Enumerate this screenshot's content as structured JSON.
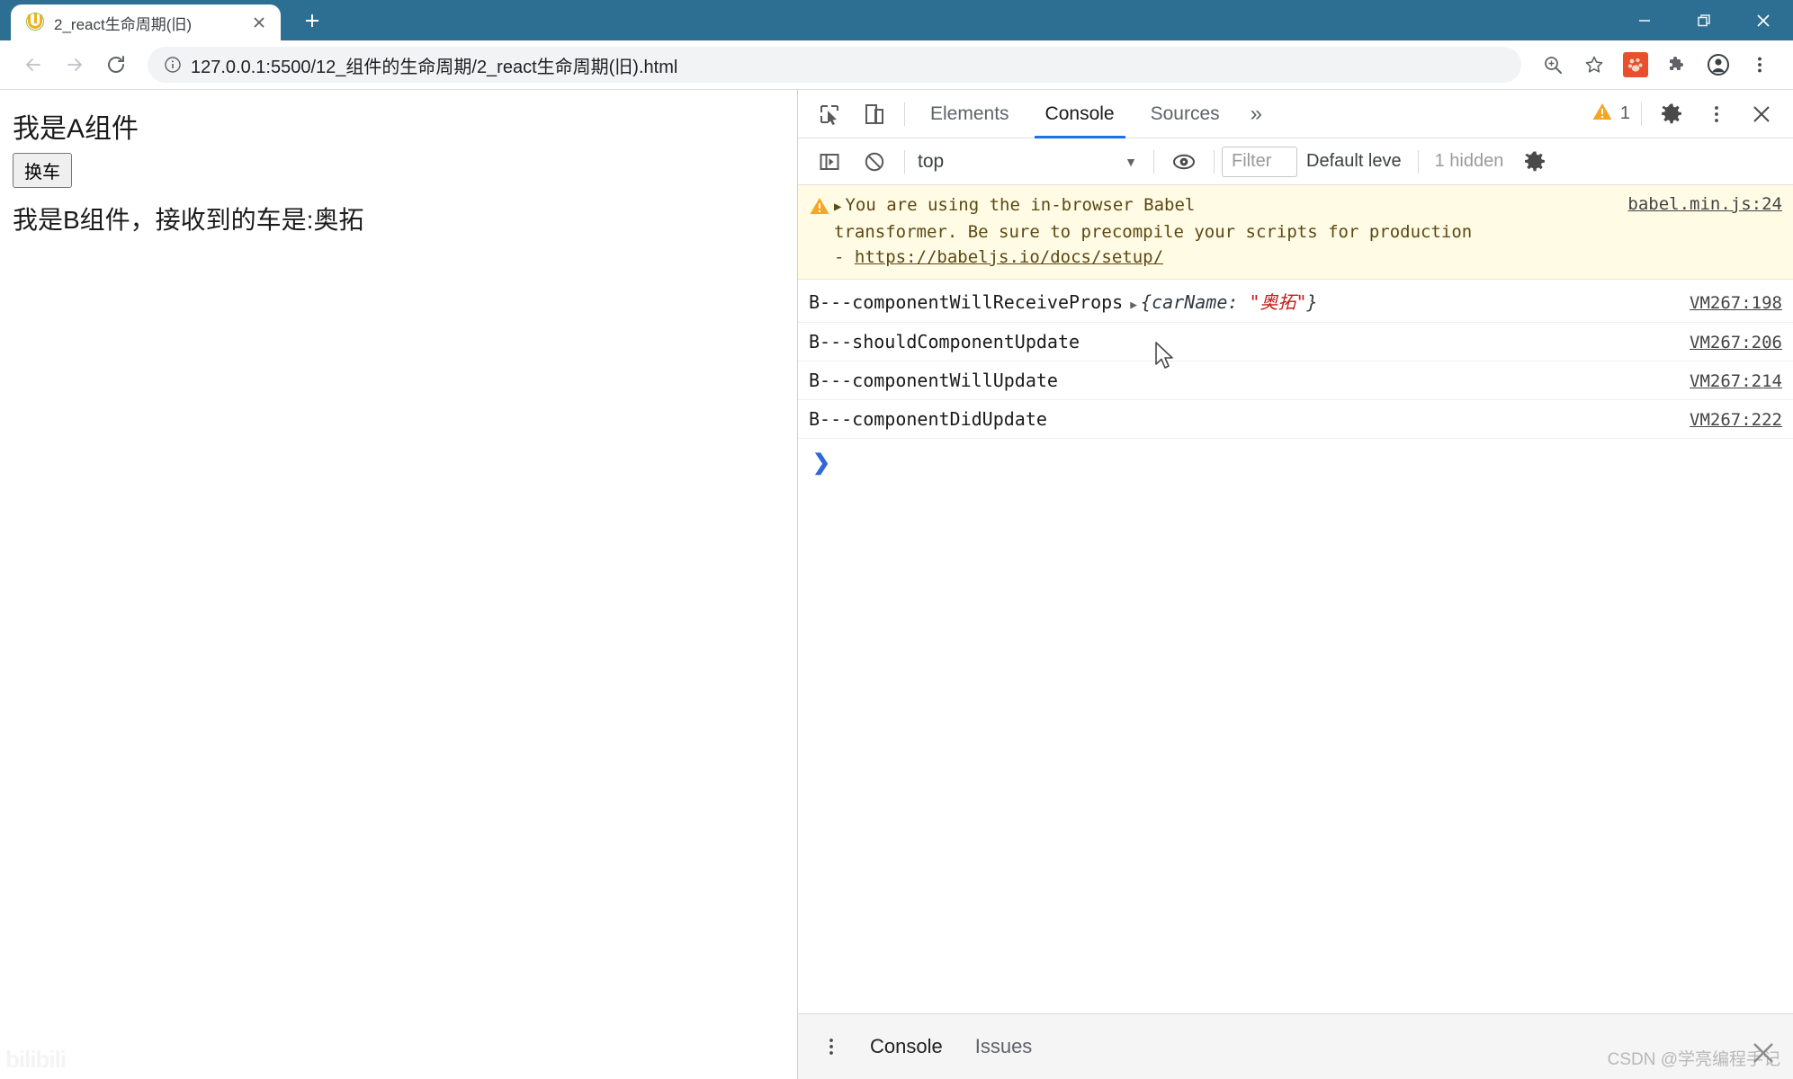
{
  "browser": {
    "tab": {
      "title": "2_react生命周期(旧)",
      "favicon": "live-server-icon",
      "close_label": "✕"
    },
    "new_tab_label": "+",
    "window_controls": {
      "minimize": "—",
      "maximize": "❐",
      "close": "✕"
    },
    "nav": {
      "back": "←",
      "forward": "→",
      "reload": "⟳"
    },
    "omnibox": {
      "info_icon": "info-circle-icon",
      "url": "127.0.0.1:5500/12_组件的生命周期/2_react生命周期(旧).html"
    },
    "toolbar_icons": [
      "zoom-icon",
      "bookmark-star-icon",
      "extension-red-icon",
      "puzzle-extensions-icon",
      "profile-avatar-icon",
      "browser-menu-icon"
    ]
  },
  "page": {
    "heading_a": "我是A组件",
    "button_label": "换车",
    "text_b": "我是B组件，接收到的车是:奥拓",
    "watermark": "bilibili"
  },
  "devtools": {
    "topbar": {
      "inspect_icon": "inspect-element-icon",
      "device_icon": "device-toolbar-icon",
      "tabs": [
        {
          "label": "Elements",
          "active": false
        },
        {
          "label": "Console",
          "active": true
        },
        {
          "label": "Sources",
          "active": false
        }
      ],
      "more_tabs": "»",
      "warning_icon": "warning-triangle-icon",
      "warning_count": "1",
      "settings_icon": "gear-icon",
      "menu_icon": "kebab-menu-icon",
      "close_icon": "close-icon"
    },
    "filterbar": {
      "sidebar_icon": "console-sidebar-icon",
      "clear_icon": "clear-console-icon",
      "context": "top",
      "context_arrow": "▼",
      "eye_icon": "live-expression-icon",
      "filter_placeholder": "Filter",
      "level": "Default leve",
      "hidden": "1 hidden",
      "settings_icon": "console-settings-gear-icon"
    },
    "messages": [
      {
        "type": "warning",
        "icon": "warning-triangle-icon",
        "disclosure": "▶",
        "text_line1": "You are using the in-browser Babel",
        "text_line2": "transformer. Be sure to precompile your scripts for production",
        "text_line3_prefix": "- ",
        "link": "https://babeljs.io/docs/setup/",
        "source": "babel.min.js:24"
      },
      {
        "type": "log",
        "text": "B---componentWillReceiveProps",
        "object_arrow": "▶",
        "object_open": "{carName: ",
        "object_string": "\"奥拓\"",
        "object_close": "}",
        "source": "VM267:198"
      },
      {
        "type": "log",
        "text": "B---shouldComponentUpdate",
        "source": "VM267:206"
      },
      {
        "type": "log",
        "text": "B---componentWillUpdate",
        "source": "VM267:214"
      },
      {
        "type": "log",
        "text": "B---componentDidUpdate",
        "source": "VM267:222"
      }
    ],
    "prompt_arrow": "❯",
    "drawer": {
      "menu_icon": "kebab-menu-icon",
      "tabs": [
        {
          "label": "Console",
          "active": true
        },
        {
          "label": "Issues",
          "active": false
        }
      ]
    }
  },
  "watermark": {
    "csdn": "CSDN @学亮编程手记"
  },
  "colors": {
    "titlebar": "#2d6f92",
    "accent": "#1a73e8",
    "warning_bg": "#fffbe5",
    "warning_text": "#5c4813",
    "string_red": "#c41a16",
    "prompt_blue": "#3367d6"
  }
}
